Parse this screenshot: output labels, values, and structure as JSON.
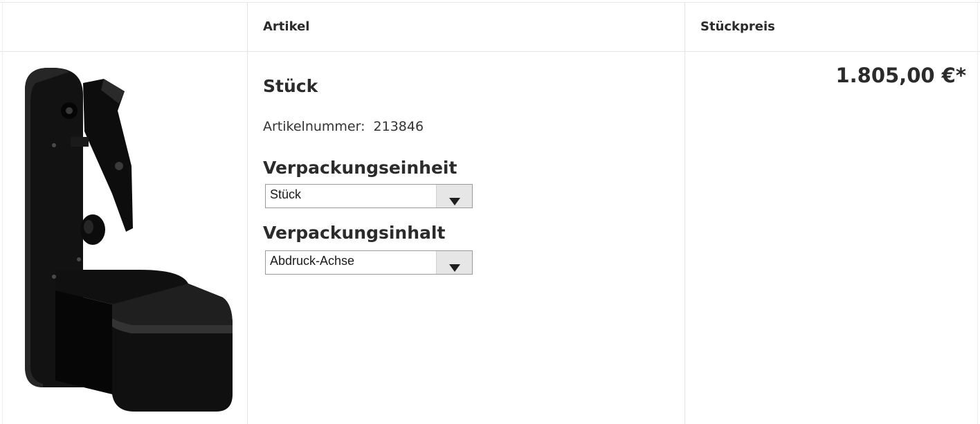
{
  "table": {
    "headers": {
      "image": "",
      "article": "Artikel",
      "unit_price": "Stückpreis"
    }
  },
  "product": {
    "title": "Stück",
    "article_number_label": "Artikelnummer:",
    "article_number": "213846",
    "price": "1.805,00 €*",
    "image_icon": "product-holder-image"
  },
  "selects": [
    {
      "label": "Verpackungseinheit",
      "value": "Stück"
    },
    {
      "label": "Verpackungsinhalt",
      "value": "Abdruck-Achse"
    }
  ],
  "colors": {
    "text": "#2b2b2b",
    "border": "#e4e4e4",
    "select_button": "#e6e6e6"
  }
}
